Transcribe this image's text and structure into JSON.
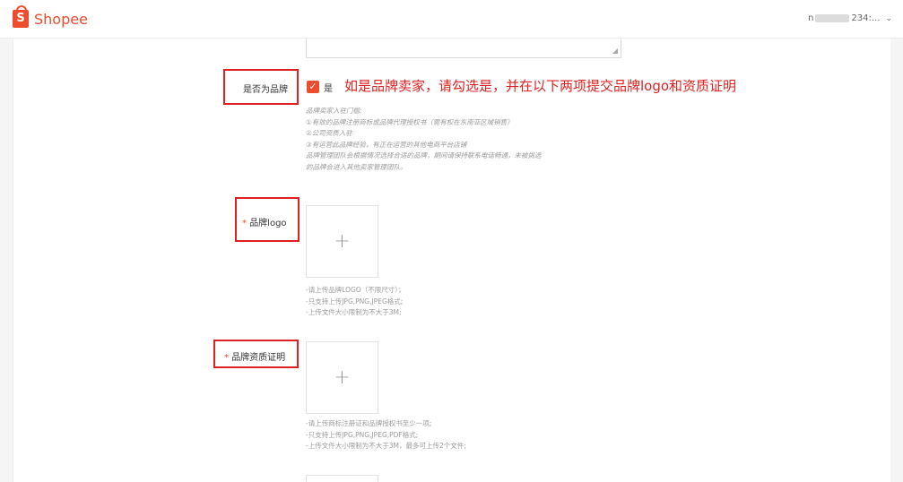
{
  "header": {
    "brand": "Shopee",
    "logo_letter": "S",
    "user_prefix": "n",
    "user_suffix": "234:...",
    "chevron": "⌄"
  },
  "brand_row": {
    "label": "是否为品牌",
    "checkbox_label": "是",
    "checked": true,
    "annotation": "如是品牌卖家，请勾选是，并在以下两项提交品牌logo和资质证明"
  },
  "brand_hint": [
    "品牌卖家入驻门槛:",
    "①有效的品牌注册商标或品牌代理授权书（需有权在东南亚区域销售）",
    "②公司资质入驻",
    "③有运营此品牌经验，有正在运营的其他电商平台店铺",
    "品牌管理团队会根据情况选择合适的品牌，期间请保持联系电话畅通，未被挑选",
    "的品牌会进入其他卖家管理团队。"
  ],
  "logo_field": {
    "required_mark": "*",
    "label": "品牌logo",
    "upload_symbol": "+",
    "hints": [
      "-请上传品牌LOGO（不限尺寸）；",
      "-只支持上传JPG,PNG,JPEG格式;",
      "-上传文件大小限制为不大于3M;"
    ]
  },
  "cert_field": {
    "required_mark": "*",
    "label": "品牌资质证明",
    "upload_symbol": "+",
    "hints": [
      "-请上传商标注册证和品牌授权书至少一项;",
      "-只支持上传JPG,PNG,JPEG,PDF格式;",
      "-上传文件大小限制为不大于3M，最多可上传2个文件;"
    ]
  },
  "colors": {
    "brand": "#ee4d2d",
    "annotation_red": "#e02020",
    "hint_gray": "#9a9a9a"
  }
}
